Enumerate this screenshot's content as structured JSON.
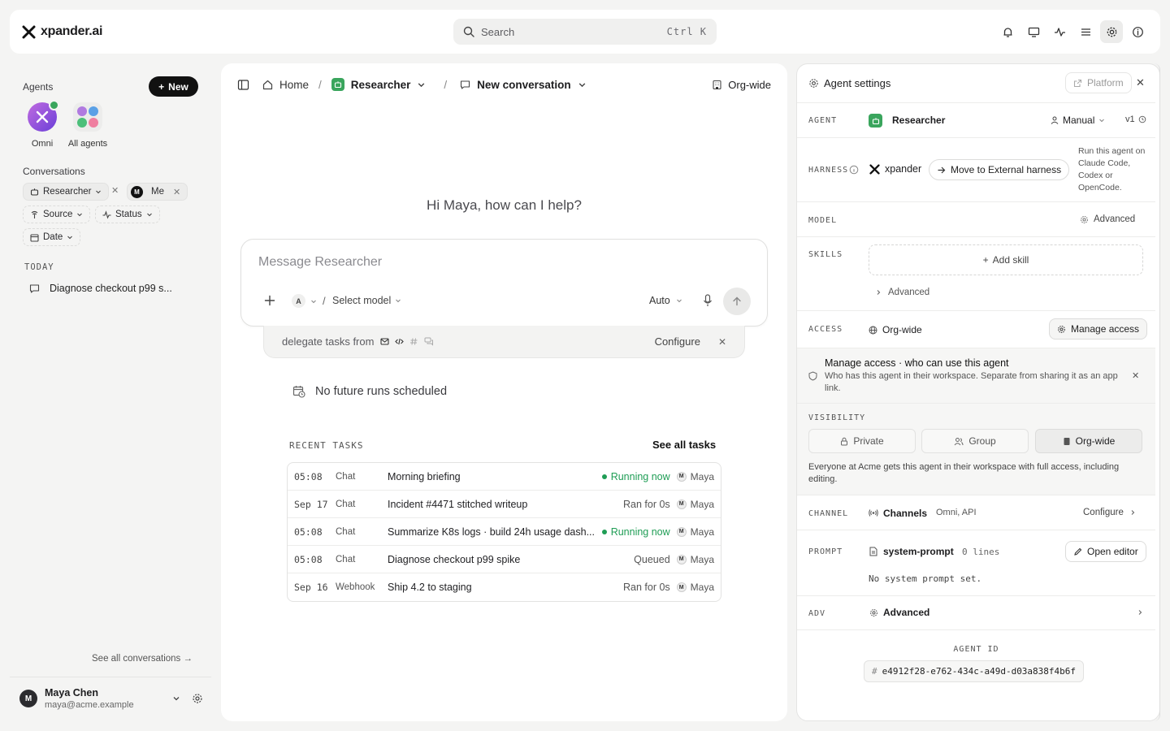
{
  "app": {
    "brand": "xpander.ai"
  },
  "search": {
    "placeholder": "Search",
    "shortcut": "Ctrl K"
  },
  "sidebar": {
    "agents_heading": "Agents",
    "new_button": "New",
    "agents": [
      {
        "label": "Omni",
        "status": "online"
      },
      {
        "label": "All agents"
      }
    ],
    "conversations_heading": "Conversations",
    "filters": {
      "agent_chip": "Researcher",
      "user_chip": "Me",
      "user_initial": "M",
      "source": "Source",
      "status": "Status",
      "date": "Date"
    },
    "today_heading": "TODAY",
    "conversations": [
      {
        "title": "Diagnose checkout p99 s..."
      }
    ],
    "see_all": "See all conversations →",
    "user": {
      "name": "Maya Chen",
      "email": "maya@acme.example",
      "initial": "M"
    }
  },
  "center": {
    "breadcrumb": {
      "home": "Home",
      "agent": "Researcher",
      "conversation": "New conversation"
    },
    "scope": "Org-wide",
    "greeting": "Hi Maya, how can I help?",
    "composer": {
      "placeholder": "Message Researcher",
      "model_initial": "A",
      "slash": "/",
      "model_select": "Select model",
      "mode": "Auto"
    },
    "delegate": {
      "text": "delegate tasks from",
      "configure": "Configure"
    },
    "no_runs": "No future runs scheduled",
    "recent_label": "RECENT TASKS",
    "see_all_tasks": "See all tasks",
    "tasks": [
      {
        "time": "05:08",
        "source": "Chat",
        "title": "Morning briefing",
        "status": "Running now",
        "running": true,
        "user": "Maya",
        "initial": "M"
      },
      {
        "time": "Sep 17",
        "source": "Chat",
        "title": "Incident #4471 stitched writeup",
        "status": "Ran for 0s",
        "running": false,
        "user": "Maya",
        "initial": "M"
      },
      {
        "time": "05:08",
        "source": "Chat",
        "title": "Summarize K8s logs · build 24h usage dash...",
        "status": "Running now",
        "running": true,
        "user": "Maya",
        "initial": "M"
      },
      {
        "time": "05:08",
        "source": "Chat",
        "title": "Diagnose checkout p99 spike",
        "status": "Queued",
        "running": false,
        "user": "Maya",
        "initial": "M"
      },
      {
        "time": "Sep 16",
        "source": "Webhook",
        "title": "Ship 4.2 to staging",
        "status": "Ran for 0s",
        "running": false,
        "user": "Maya",
        "initial": "M"
      }
    ]
  },
  "settings": {
    "title": "Agent settings",
    "platform_button": "Platform",
    "agent": {
      "label": "AGENT",
      "name": "Researcher",
      "mode": "Manual",
      "version": "v1"
    },
    "harness": {
      "label": "HARNESS",
      "name": "xpander",
      "move_button": "Move to External harness",
      "hint": "Run this agent on Claude Code, Codex or OpenCode."
    },
    "model": {
      "label": "MODEL",
      "value": "Advanced"
    },
    "skills": {
      "label": "SKILLS",
      "add": "Add skill",
      "advanced": "Advanced"
    },
    "access": {
      "label": "ACCESS",
      "value": "Org-wide",
      "manage_button": "Manage access",
      "info_title": "Manage access · who can use this agent",
      "info_text": "Who has this agent in their workspace. Separate from sharing it as an app link."
    },
    "visibility": {
      "label": "VISIBILITY",
      "options": [
        "Private",
        "Group",
        "Org-wide"
      ],
      "selected": "Org-wide",
      "note": "Everyone at Acme gets this agent in their workspace with full access, including editing."
    },
    "channel": {
      "label": "CHANNEL",
      "name": "Channels",
      "value": "Omni, API",
      "configure": "Configure"
    },
    "prompt": {
      "label": "PROMPT",
      "name": "system-prompt",
      "lines": "0 lines",
      "open_editor": "Open editor",
      "empty": "No system prompt set."
    },
    "adv": {
      "label": "ADV",
      "value": "Advanced"
    },
    "agent_id": {
      "label": "AGENT ID",
      "prefix": "#",
      "value": "e4912f28-e762-434c-a49d-d03a838f4b6f"
    }
  },
  "colors": {
    "accent": "#111111",
    "running": "#1f9d55",
    "agent_green": "#3aa55d"
  }
}
